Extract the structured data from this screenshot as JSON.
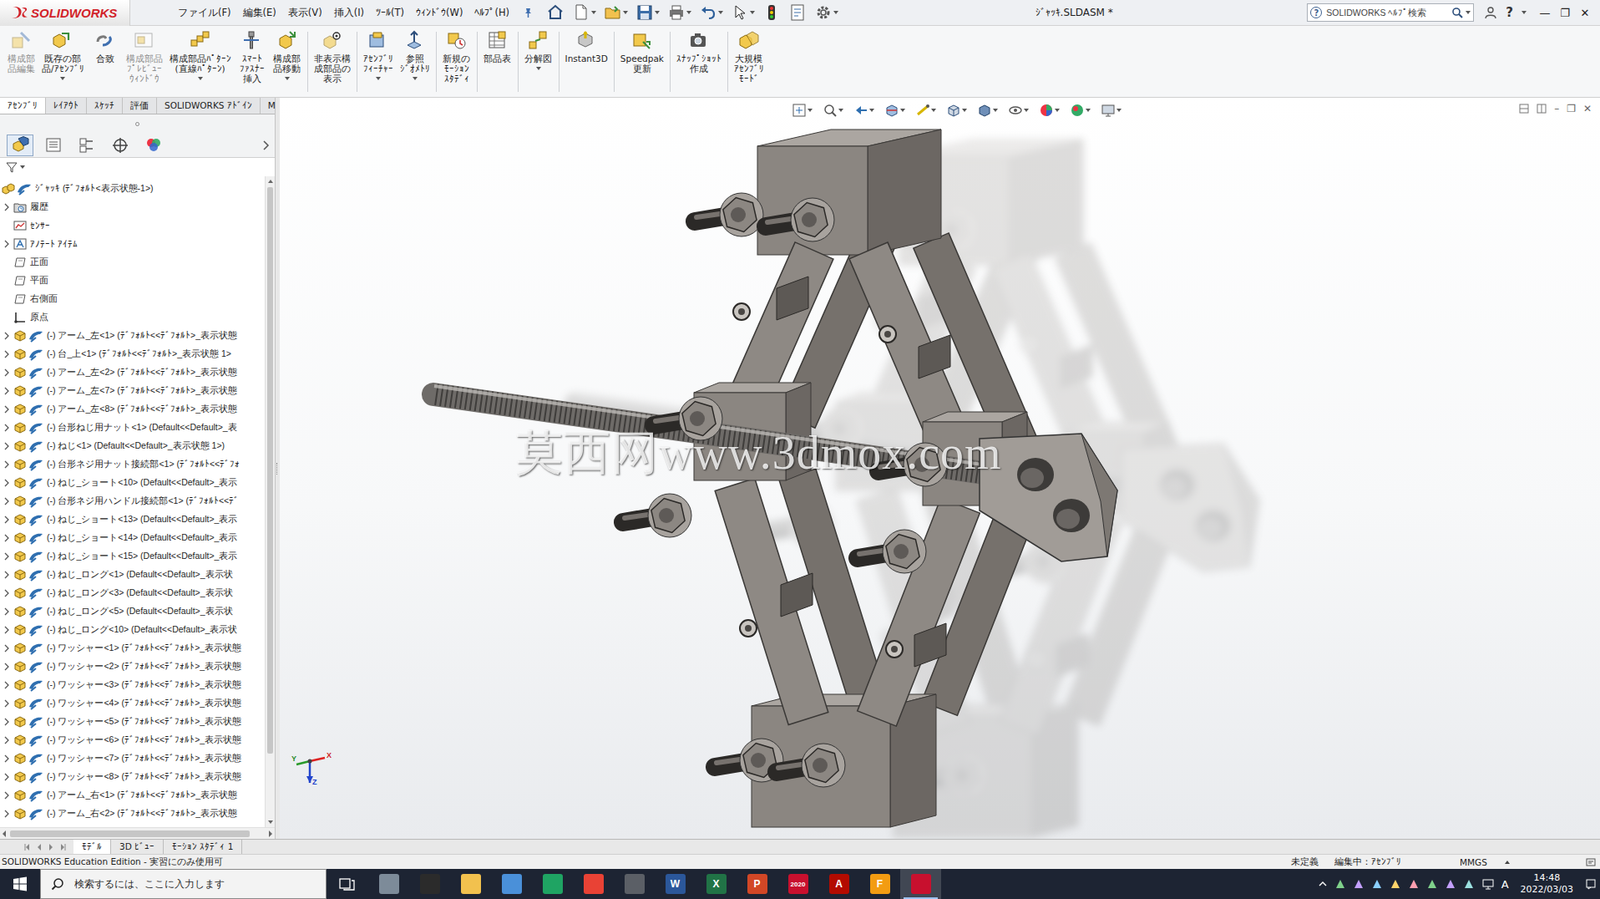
{
  "window": {
    "title": "ｼﾞｬｯｷ.SLDASM *",
    "controls": [
      "—",
      "❐",
      "✕"
    ]
  },
  "logo": "SOLIDWORKS",
  "menu": [
    "ファイル(F)",
    "編集(E)",
    "表示(V)",
    "挿入(I)",
    "ﾂｰﾙ(T)",
    "ｳｨﾝﾄﾞｳ(W)",
    "ﾍﾙﾌﾟ(H)"
  ],
  "help_search": {
    "placeholder": "SOLIDWORKS ﾍﾙﾌﾟ検索",
    "help": "?"
  },
  "ribbon": [
    {
      "label": "構成部\n品編集",
      "disabled": true,
      "dropdown": false,
      "separator_after": false
    },
    {
      "label": "既存の部\n品/ｱｾﾝﾌﾞﾘ",
      "disabled": false,
      "dropdown": true,
      "separator_after": false
    },
    {
      "label": "合致",
      "disabled": false,
      "dropdown": false,
      "separator_after": false
    },
    {
      "label": "構成部品\nﾌﾟﾚﾋﾞｭｰ\nｳｨﾝﾄﾞｳ",
      "disabled": true,
      "dropdown": false,
      "separator_after": false
    },
    {
      "label": "構成部品ﾊﾟﾀｰﾝ\n(直線ﾊﾟﾀｰﾝ)",
      "disabled": false,
      "dropdown": true,
      "separator_after": false
    },
    {
      "label": "ｽﾏｰﾄ\nﾌｧｽﾅｰ\n挿入",
      "disabled": false,
      "dropdown": false,
      "separator_after": false
    },
    {
      "label": "構成部\n品移動",
      "disabled": false,
      "dropdown": true,
      "separator_after": true
    },
    {
      "label": "非表示構\n成部品の\n表示",
      "disabled": false,
      "dropdown": false,
      "separator_after": true
    },
    {
      "label": "ｱｾﾝﾌﾞﾘ\nﾌｨｰﾁｬｰ",
      "disabled": false,
      "dropdown": true,
      "separator_after": false
    },
    {
      "label": "参照\nｼﾞｵﾒﾄﾘ",
      "disabled": false,
      "dropdown": true,
      "separator_after": true
    },
    {
      "label": "新規の\nﾓｰｼｮﾝ\nｽﾀﾃﾞｨ",
      "disabled": false,
      "dropdown": false,
      "separator_after": true
    },
    {
      "label": "部品表",
      "disabled": false,
      "dropdown": false,
      "separator_after": true
    },
    {
      "label": "分解図",
      "disabled": false,
      "dropdown": true,
      "separator_after": true
    },
    {
      "label": "Instant3D",
      "disabled": false,
      "dropdown": false,
      "separator_after": true
    },
    {
      "label": "Speedpak\n更新",
      "disabled": false,
      "dropdown": false,
      "separator_after": true
    },
    {
      "label": "ｽﾅｯﾌﾟｼｮｯﾄ\n作成",
      "disabled": false,
      "dropdown": false,
      "separator_after": true
    },
    {
      "label": "大規模\nｱｾﾝﾌﾞﾘ\nﾓｰﾄﾞ",
      "disabled": false,
      "dropdown": false,
      "separator_after": false
    }
  ],
  "command_tabs": [
    {
      "label": "ｱｾﾝﾌﾞﾘ",
      "selected": true
    },
    {
      "label": "ﾚｲｱｳﾄ",
      "selected": false
    },
    {
      "label": "ｽｹｯﾁ",
      "selected": false
    },
    {
      "label": "評価",
      "selected": false
    },
    {
      "label": "SOLIDWORKS ｱﾄﾞｲﾝ",
      "selected": false
    },
    {
      "label": "MBD",
      "selected": false
    }
  ],
  "panel_tabs": [
    {
      "selected": true
    },
    {
      "selected": false
    },
    {
      "selected": false
    },
    {
      "selected": false
    },
    {
      "selected": false
    }
  ],
  "tree": {
    "items": [
      {
        "text": "ｼﾞｬｯｷ (ﾃﾞﾌｫﾙﾄ<表示状態-1>)",
        "kind": "root",
        "expandable": false
      },
      {
        "text": "履歴",
        "kind": "history",
        "expandable": true
      },
      {
        "text": "ｾﾝｻｰ",
        "kind": "sensor",
        "expandable": false
      },
      {
        "text": "ｱﾉﾃｰﾄ ｱｲﾃﾑ",
        "kind": "annotation",
        "expandable": true
      },
      {
        "text": "正面",
        "kind": "plane",
        "expandable": false
      },
      {
        "text": "平面",
        "kind": "plane",
        "expandable": false
      },
      {
        "text": "右側面",
        "kind": "plane",
        "expandable": false
      },
      {
        "text": "原点",
        "kind": "origin",
        "expandable": false
      },
      {
        "text": "(-) アーム_左<1> (ﾃﾞﾌｫﾙﾄ<<ﾃﾞﾌｫﾙﾄ>_表示状態",
        "kind": "part",
        "expandable": true
      },
      {
        "text": "(-) 台_上<1> (ﾃﾞﾌｫﾙﾄ<<ﾃﾞﾌｫﾙﾄ>_表示状態 1>",
        "kind": "part",
        "expandable": true
      },
      {
        "text": "(-) アーム_左<2> (ﾃﾞﾌｫﾙﾄ<<ﾃﾞﾌｫﾙﾄ>_表示状態",
        "kind": "part",
        "expandable": true
      },
      {
        "text": "(-) アーム_左<7> (ﾃﾞﾌｫﾙﾄ<<ﾃﾞﾌｫﾙﾄ>_表示状態",
        "kind": "part",
        "expandable": true
      },
      {
        "text": "(-) アーム_左<8> (ﾃﾞﾌｫﾙﾄ<<ﾃﾞﾌｫﾙﾄ>_表示状態",
        "kind": "part",
        "expandable": true
      },
      {
        "text": "(-) 台形ねじ用ナット<1> (Default<<Default>_表",
        "kind": "part",
        "expandable": true
      },
      {
        "text": "(-) ねじ<1> (Default<<Default>_表示状態 1>)",
        "kind": "part",
        "expandable": true
      },
      {
        "text": "(-) 台形ネジ用ナット接続部<1> (ﾃﾞﾌｫﾙﾄ<<ﾃﾞﾌｫ",
        "kind": "part",
        "expandable": true
      },
      {
        "text": "(-) ねじ_ショート<10> (Default<<Default>_表示",
        "kind": "part",
        "expandable": true
      },
      {
        "text": "(-) 台形ネジ用ハンドル接続部<1> (ﾃﾞﾌｫﾙﾄ<<ﾃﾞ",
        "kind": "part",
        "expandable": true
      },
      {
        "text": "(-) ねじ_ショート<13> (Default<<Default>_表示",
        "kind": "part",
        "expandable": true
      },
      {
        "text": "(-) ねじ_ショート<14> (Default<<Default>_表示",
        "kind": "part",
        "expandable": true
      },
      {
        "text": "(-) ねじ_ショート<15> (Default<<Default>_表示",
        "kind": "part",
        "expandable": true
      },
      {
        "text": "(-) ねじ_ロング<1> (Default<<Default>_表示状",
        "kind": "part",
        "expandable": true
      },
      {
        "text": "(-) ねじ_ロング<3> (Default<<Default>_表示状",
        "kind": "part",
        "expandable": true
      },
      {
        "text": "(-) ねじ_ロング<5> (Default<<Default>_表示状",
        "kind": "part",
        "expandable": true
      },
      {
        "text": "(-) ねじ_ロング<10> (Default<<Default>_表示状",
        "kind": "part",
        "expandable": true
      },
      {
        "text": "(-) ワッシャー<1> (ﾃﾞﾌｫﾙﾄ<<ﾃﾞﾌｫﾙﾄ>_表示状態",
        "kind": "part",
        "expandable": true
      },
      {
        "text": "(-) ワッシャー<2> (ﾃﾞﾌｫﾙﾄ<<ﾃﾞﾌｫﾙﾄ>_表示状態",
        "kind": "part",
        "expandable": true
      },
      {
        "text": "(-) ワッシャー<3> (ﾃﾞﾌｫﾙﾄ<<ﾃﾞﾌｫﾙﾄ>_表示状態",
        "kind": "part",
        "expandable": true
      },
      {
        "text": "(-) ワッシャー<4> (ﾃﾞﾌｫﾙﾄ<<ﾃﾞﾌｫﾙﾄ>_表示状態",
        "kind": "part",
        "expandable": true
      },
      {
        "text": "(-) ワッシャー<5> (ﾃﾞﾌｫﾙﾄ<<ﾃﾞﾌｫﾙﾄ>_表示状態",
        "kind": "part",
        "expandable": true
      },
      {
        "text": "(-) ワッシャー<6> (ﾃﾞﾌｫﾙﾄ<<ﾃﾞﾌｫﾙﾄ>_表示状態",
        "kind": "part",
        "expandable": true
      },
      {
        "text": "(-) ワッシャー<7> (ﾃﾞﾌｫﾙﾄ<<ﾃﾞﾌｫﾙﾄ>_表示状態",
        "kind": "part",
        "expandable": true
      },
      {
        "text": "(-) ワッシャー<8> (ﾃﾞﾌｫﾙﾄ<<ﾃﾞﾌｫﾙﾄ>_表示状態",
        "kind": "part",
        "expandable": true
      },
      {
        "text": "(-) アーム_右<1> (ﾃﾞﾌｫﾙﾄ<<ﾃﾞﾌｫﾙﾄ>_表示状態",
        "kind": "part",
        "expandable": true
      },
      {
        "text": "(-) アーム_右<2> (ﾃﾞﾌｫﾙﾄ<<ﾃﾞﾌｫﾙﾄ>_表示状態",
        "kind": "part",
        "expandable": true
      }
    ],
    "scroll_level": 0.9,
    "hscroll_level": 0.94
  },
  "viewport": {
    "watermark": "莫西网www.3dmox.com",
    "triad": [
      "Y",
      "X",
      "Z"
    ],
    "controls": [
      "–",
      "❐",
      "✕"
    ]
  },
  "bottom_tabs": [
    {
      "label": "ﾓﾃﾞﾙ",
      "selected": true
    },
    {
      "label": "3D ﾋﾞｭｰ",
      "selected": false
    },
    {
      "label": "ﾓｰｼｮﾝ ｽﾀﾃﾞｨ 1",
      "selected": false
    }
  ],
  "status_bar": {
    "edition": "SOLIDWORKS Education Edition - 実習にのみ使用可",
    "items": [
      "未定義",
      "編集中：ｱｾﾝﾌﾞﾘ",
      "MMGS"
    ]
  },
  "taskbar": {
    "search": {
      "placeholder": "検索するには、ここに入力します"
    },
    "apps": [
      {
        "glyph": "",
        "color": "#7d8b99",
        "active": false
      },
      {
        "glyph": "",
        "color": "#2b2b2b",
        "active": false
      },
      {
        "glyph": "",
        "color": "#f2c14e",
        "active": false
      },
      {
        "glyph": "",
        "color": "#4a90d9",
        "active": false
      },
      {
        "glyph": "",
        "color": "#1fa463",
        "active": false
      },
      {
        "glyph": "",
        "color": "#e94235",
        "active": false
      },
      {
        "glyph": "",
        "color": "#5b5f66",
        "active": false
      },
      {
        "glyph": "W",
        "color": "#2b579a",
        "active": false
      },
      {
        "glyph": "X",
        "color": "#217346",
        "active": false
      },
      {
        "glyph": "P",
        "color": "#d24726",
        "active": false
      },
      {
        "glyph": "2020",
        "color": "#c8102e",
        "active": false
      },
      {
        "glyph": "A",
        "color": "#b30b00",
        "active": false
      },
      {
        "glyph": "F",
        "color": "#f39c12",
        "active": false
      },
      {
        "glyph": "",
        "color": "#c8102e",
        "active": true
      }
    ],
    "ime": "A",
    "time": "14:48",
    "date": "2022/03/03"
  }
}
